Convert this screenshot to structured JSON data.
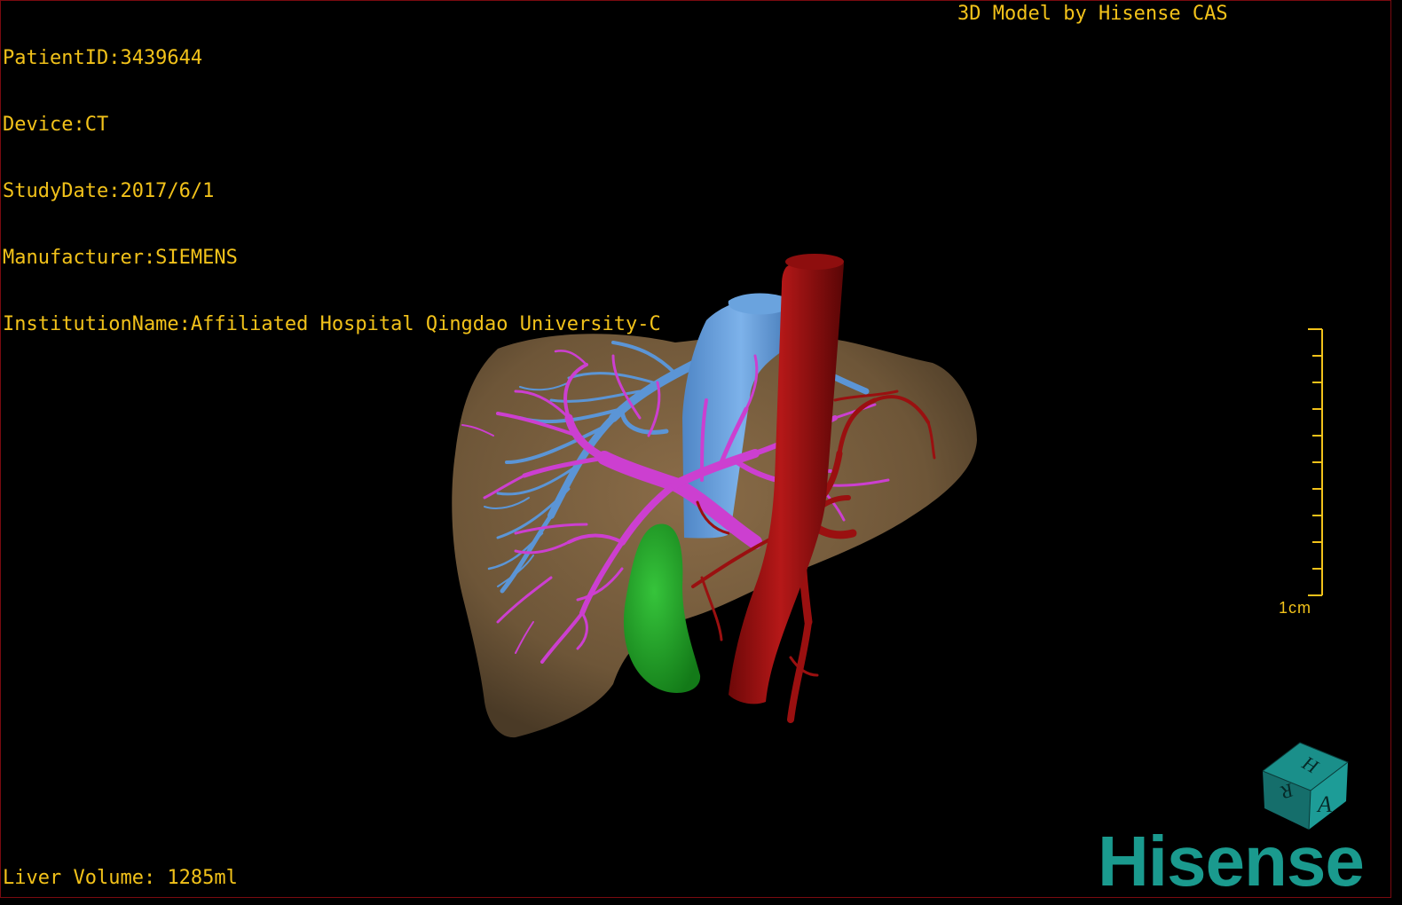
{
  "overlay": {
    "patient_id": "PatientID:3439644",
    "device": "Device:CT",
    "study_date": "StudyDate:2017/6/1",
    "manufacturer": "Manufacturer:SIEMENS",
    "institution": "InstitutionName:Affiliated Hospital Qingdao University-C",
    "model_credit": "3D Model by Hisense CAS",
    "liver_volume": "Liver Volume: 1285ml"
  },
  "scale": {
    "label": "1cm"
  },
  "orientation_cube": {
    "faces": [
      "H",
      "R",
      "A"
    ]
  },
  "logo": {
    "text": "Hisense"
  },
  "colors": {
    "text": "#f2c21a",
    "liver": "#7a6040",
    "hepatic_vein": "#5b95d6",
    "portal_vein": "#cc3fd0",
    "artery": "#9a1010",
    "gallbladder": "#1fa326",
    "brand": "#1a9a8e"
  }
}
